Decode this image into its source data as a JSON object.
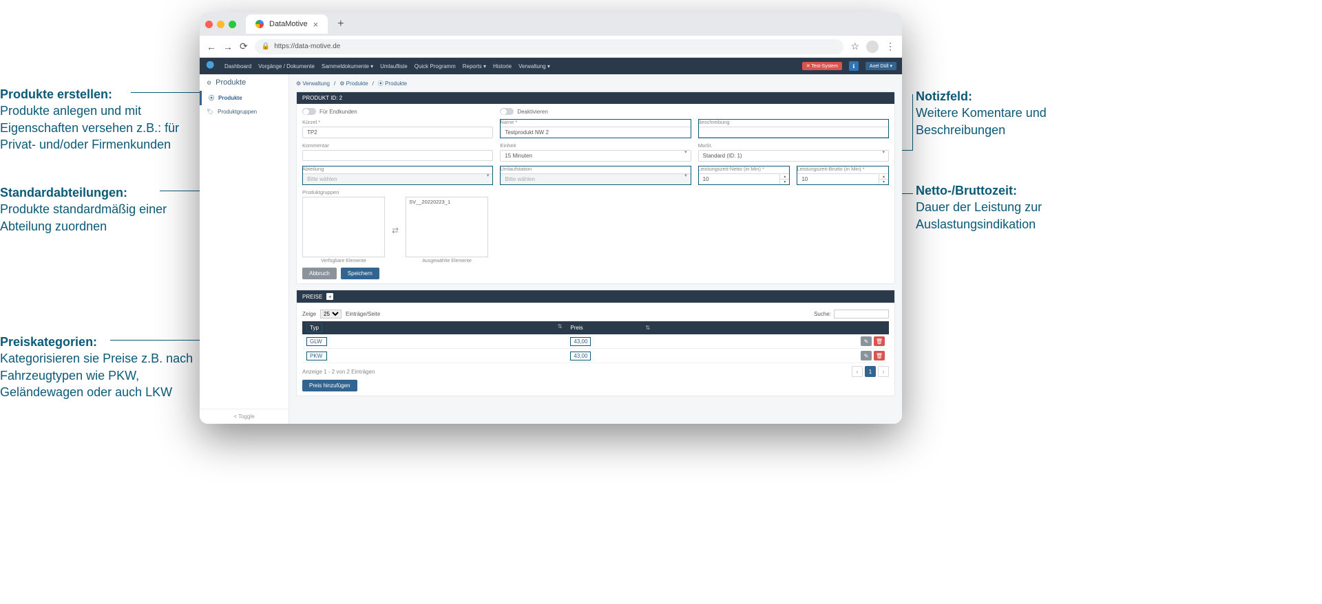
{
  "browser": {
    "tab_title": "DataMotive",
    "url": "https://data-motive.de"
  },
  "topnav": {
    "items": [
      "Dashboard",
      "Vorgänge / Dokumente",
      "Sammeldokumente ▾",
      "Umlaufliste",
      "Quick Programm",
      "Reports ▾",
      "Historie",
      "Verwaltung ▾"
    ],
    "env_badge": "✕ Test-System",
    "info_badge": "ℹ",
    "user_badge": "Axel Düll ▾"
  },
  "sidebar": {
    "title": "Produkte",
    "items": [
      {
        "label": "Produkte",
        "icon": "⦿",
        "active": true
      },
      {
        "label": "Produktgruppen",
        "icon": "🏷",
        "active": false
      }
    ],
    "toggle": "< Toggle"
  },
  "breadcrumb": [
    "⚙ Verwaltung",
    "⚙ Produkte",
    "⦿ Produkte"
  ],
  "product_panel": {
    "header": "PRODUKT ID: 2",
    "toggles": {
      "endkunden": "Für Endkunden",
      "deaktivieren": "Deaktivieren"
    },
    "fields": {
      "kuerzel_label": "Kürzel *",
      "kuerzel_value": "TP2",
      "name_label": "Name *",
      "name_value": "Testprodukt NW 2",
      "beschreibung_label": "Beschreibung",
      "beschreibung_value": "",
      "kommentar_label": "Kommentar",
      "kommentar_value": "",
      "einheit_label": "Einheit",
      "einheit_value": "15 Minuten",
      "mwst_label": "MwSt.",
      "mwst_value": "Standard (ID: 1)",
      "abteilung_label": "Abteilung",
      "abteilung_value": "Bitte wählen",
      "umlaufstation_label": "Umlaufstation",
      "umlaufstation_value": "Bitte wählen",
      "netto_label": "Leistungszeit-Netto (in Min) *",
      "netto_value": "10",
      "brutto_label": "Leistungszeit-Brutto (in Min) *",
      "brutto_value": "10",
      "produktgruppen_label": "Produktgruppen"
    },
    "duallist": {
      "available_caption": "Verfügbare Elemente",
      "selected_caption": "Ausgewählte Elemente",
      "selected_items": [
        "SV__20220223_1"
      ]
    },
    "buttons": {
      "cancel": "Abbruch",
      "save": "Speichern"
    }
  },
  "price_panel": {
    "header": "PREISE",
    "show_label": "Zeige",
    "page_size": "25",
    "entries_label": "Einträge/Seite",
    "search_label": "Suche:",
    "columns": {
      "typ": "Typ",
      "preis": "Preis"
    },
    "rows": [
      {
        "typ": "GLW",
        "preis": "43,00"
      },
      {
        "typ": "PKW",
        "preis": "43,00"
      }
    ],
    "info": "Anzeige 1 - 2 von 2 Einträgen",
    "add_price": "Preis hinzufügen",
    "page_current": "1"
  },
  "callouts": {
    "produkte_title": "Produkte erstellen:",
    "produkte_body": "Produkte anlegen und mit Eigenschaften versehen z.B.: für Privat- und/oder Firmenkunden",
    "abteilung_title": "Standardabteilungen:",
    "abteilung_body": "Produkte standardmäßig einer Abteilung zuordnen",
    "preis_title": "Preiskategorien:",
    "preis_body": "Kategorisieren sie Preise z.B. nach Fahrzeugtypen wie PKW, Geländewagen oder auch LKW",
    "notiz_title": "Notizfeld:",
    "notiz_body": "Weitere Komentare und Beschreibungen",
    "zeit_title": "Netto-/Bruttozeit:",
    "zeit_body": "Dauer der Leistung zur Auslastungsindikation"
  }
}
